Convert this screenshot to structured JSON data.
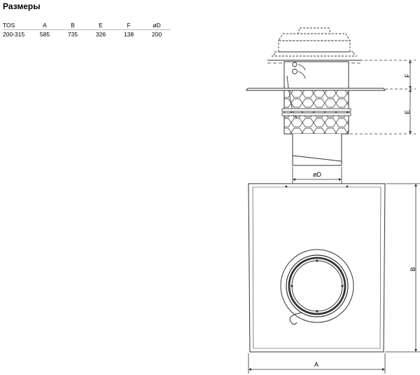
{
  "title": "Размеры",
  "table": {
    "headers": [
      "TOS",
      "A",
      "B",
      "E",
      "F",
      "øD"
    ],
    "rows": [
      [
        "200-315",
        "585",
        "735",
        "326",
        "138",
        "200"
      ]
    ]
  },
  "drawing": {
    "labels": {
      "F": "F",
      "E": "E",
      "D": "øD",
      "B": "B",
      "A": "A"
    }
  }
}
